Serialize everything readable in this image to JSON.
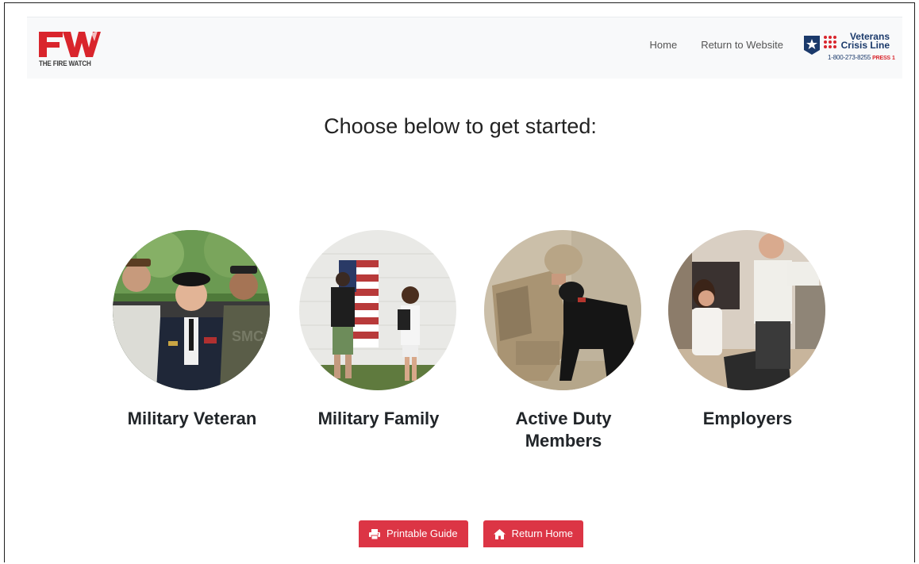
{
  "brand": {
    "logo_letters": "FW",
    "logo_text": "THE FIRE WATCH",
    "accent": "#d9252c"
  },
  "nav": {
    "links": [
      {
        "label": "Home"
      },
      {
        "label": "Return to Website"
      }
    ]
  },
  "crisis_line": {
    "title_line1": "Veterans",
    "title_line2": "Crisis Line",
    "phone": "1-800-273-8255",
    "press": "PRESS",
    "press_number": "1",
    "icons": [
      "flag-star-icon",
      "dots-grid-icon"
    ]
  },
  "main": {
    "heading": "Choose below to get started:",
    "cards": [
      {
        "label": "Military Veteran"
      },
      {
        "label": "Military Family"
      },
      {
        "label": "Active Duty Members"
      },
      {
        "label": "Employers"
      }
    ]
  },
  "actions": {
    "printable_guide": "Printable Guide",
    "return_home": "Return Home",
    "icons": [
      "printer-icon",
      "home-icon"
    ],
    "button_color": "#dc3545"
  }
}
